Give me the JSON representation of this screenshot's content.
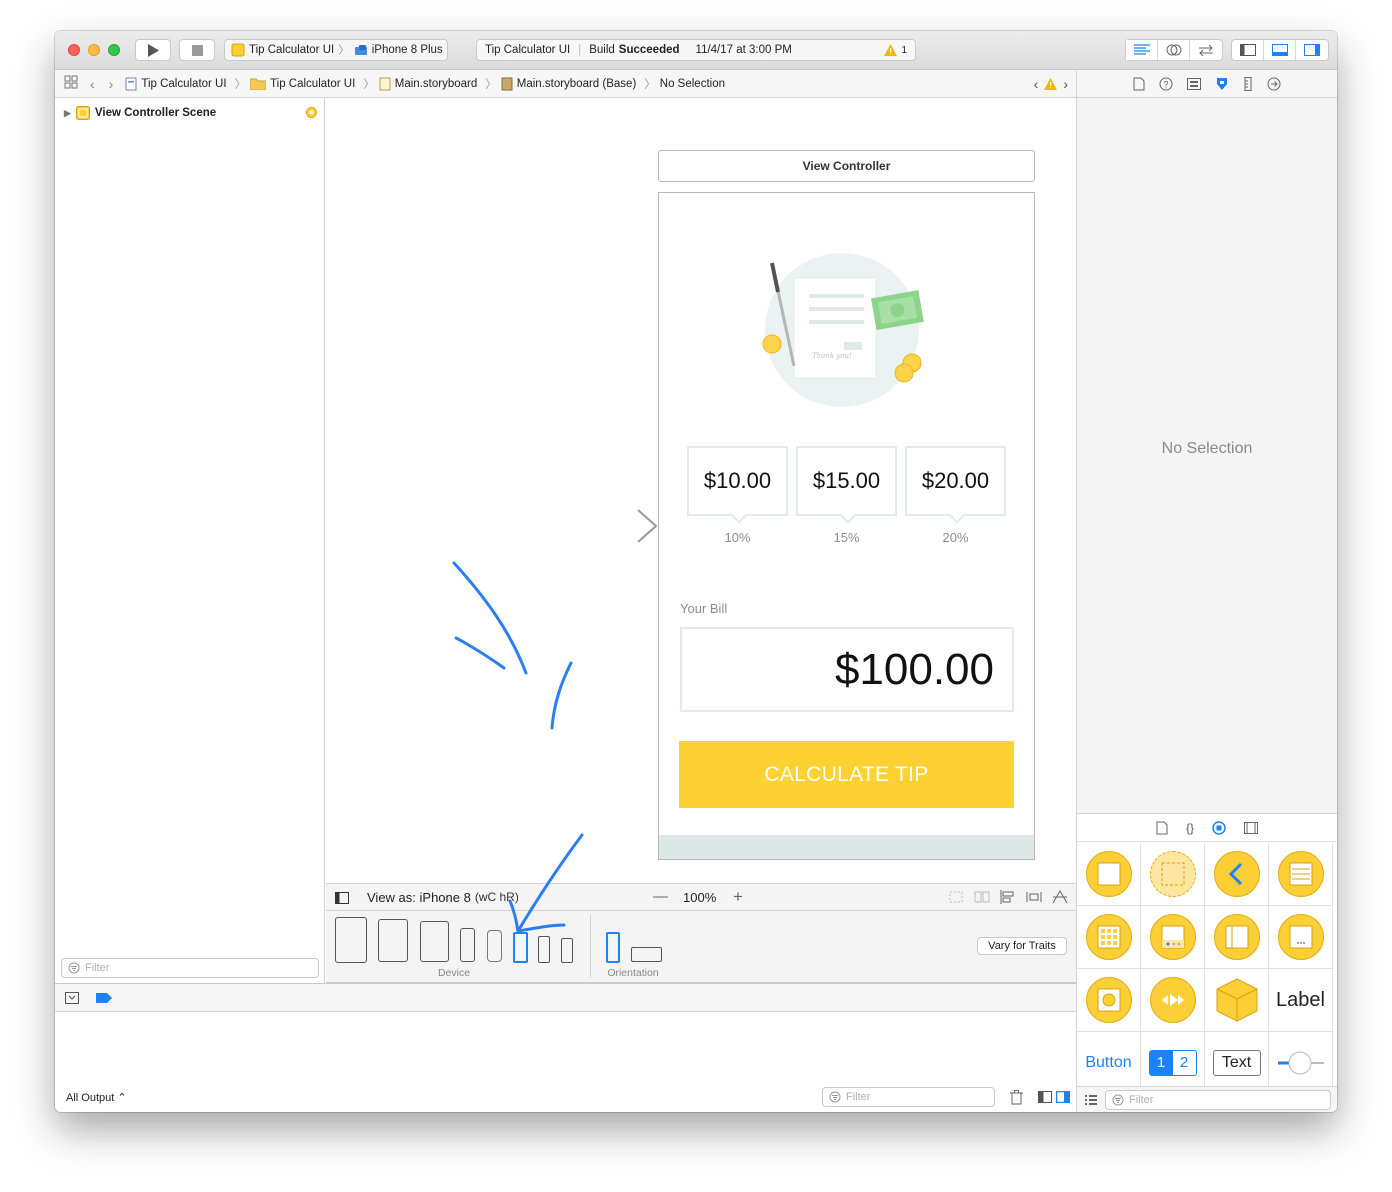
{
  "toolbar": {
    "scheme_target": "Tip Calculator UI",
    "scheme_device": "iPhone 8 Plus",
    "activity_project": "Tip Calculator UI",
    "activity_status_prefix": "Build",
    "activity_status": "Succeeded",
    "activity_time": "11/4/17 at 3:00 PM",
    "warning_count": "1"
  },
  "jumpbar": {
    "crumbs": [
      "Tip Calculator UI",
      "Tip Calculator UI",
      "Main.storyboard",
      "Main.storyboard (Base)",
      "No Selection"
    ]
  },
  "navigator": {
    "scene": "View Controller Scene",
    "filter_placeholder": "Filter"
  },
  "scene": {
    "title": "View Controller",
    "tips": [
      {
        "amount": "$10.00",
        "percent": "10%"
      },
      {
        "amount": "$15.00",
        "percent": "15%"
      },
      {
        "amount": "$20.00",
        "percent": "20%"
      }
    ],
    "bill_label": "Your Bill",
    "bill_amount": "$100.00",
    "calculate_button": "CALCULATE TIP",
    "illustration_text": "Thank you!"
  },
  "viewas": {
    "label": "View as: iPhone 8",
    "traits": "(wC hR)",
    "zoom": "100%",
    "minus": "—",
    "plus": "+"
  },
  "devices": {
    "device_label": "Device",
    "orientation_label": "Orientation",
    "vary_button": "Vary for Traits"
  },
  "inspector": {
    "empty": "No Selection"
  },
  "library": {
    "label_item": "Label",
    "button_item": "Button",
    "seg_1": "1",
    "seg_2": "2",
    "text_item": "Text",
    "filter_placeholder": "Filter"
  },
  "debug": {
    "output": "All Output ⌃",
    "filter_placeholder": "Filter"
  },
  "colors": {
    "accent": "#1a82fb",
    "button_yellow": "#fdd131",
    "annotation_blue": "#2a7ff0",
    "warning": "#f5b800"
  }
}
